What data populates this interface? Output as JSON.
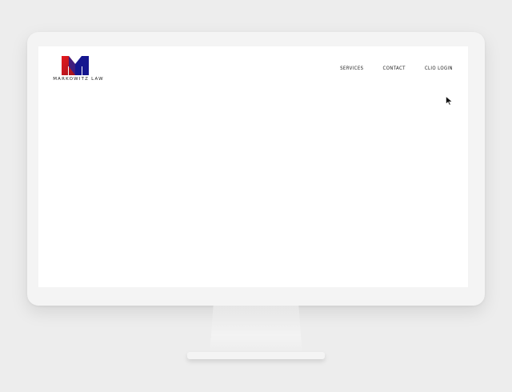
{
  "header": {
    "logo": {
      "text": "MARKOWITZ LAW",
      "icon": "markowitz-m-logo",
      "colors": {
        "red": "#d9161c",
        "blue": "#15168f"
      }
    },
    "nav": [
      {
        "label": "SERVICES"
      },
      {
        "label": "CONTACT"
      },
      {
        "label": "CLIO LOGIN"
      }
    ]
  },
  "cursor": {
    "icon": "mouse-pointer-icon"
  }
}
